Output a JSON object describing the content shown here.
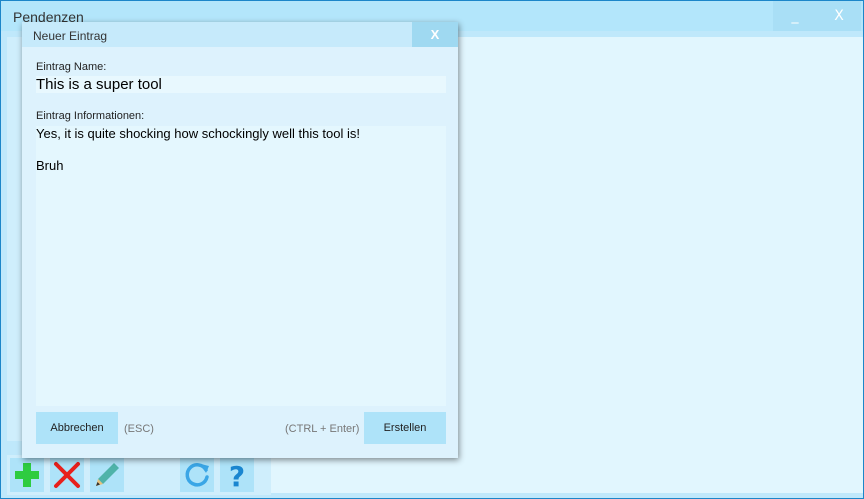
{
  "app": {
    "title": "Pendenzen",
    "minimize_symbol": "_",
    "close_symbol": "X"
  },
  "toolbar": [
    {
      "name": "add",
      "icon": "plus-icon",
      "color": "#2ecc40"
    },
    {
      "name": "delete",
      "icon": "x-icon",
      "color": "#e8201c"
    },
    {
      "name": "edit",
      "icon": "pencil-icon",
      "color": "#4fb3a9"
    },
    {
      "name": "refresh",
      "icon": "refresh-icon",
      "color": "#3aa6e6"
    },
    {
      "name": "help",
      "icon": "question-icon",
      "color": "#1a86d0"
    }
  ],
  "dialog": {
    "title": "Neuer Eintrag",
    "close_symbol": "X",
    "name_label": "Eintrag Name:",
    "name_value": "This is a super tool",
    "info_label": "Eintrag Informationen:",
    "info_value": "Yes, it is quite shocking how schockingly well this tool is!\n\nBruh",
    "cancel_label": "Abbrechen",
    "cancel_shortcut": "(ESC)",
    "create_shortcut": "(CTRL + Enter)",
    "create_label": "Erstellen"
  }
}
